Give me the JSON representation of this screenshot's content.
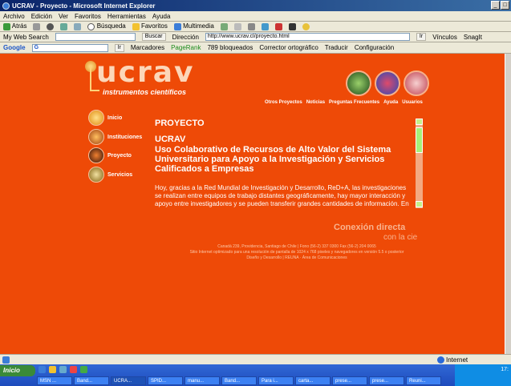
{
  "window": {
    "title": "UCRAV - Proyecto - Microsoft Internet Explorer"
  },
  "menu": [
    "Archivo",
    "Edición",
    "Ver",
    "Favoritos",
    "Herramientas",
    "Ayuda"
  ],
  "nav": {
    "back": "Atrás",
    "search": "Búsqueda",
    "favorites": "Favoritos",
    "multimedia": "Multimedia"
  },
  "addressbar": {
    "label_search": "My Web Search",
    "buscar": "Buscar",
    "label_dir": "Dirección",
    "url": "http://www.ucrav.cl/proyecto.html",
    "go": "Ir",
    "links": "Vínculos",
    "snagit": "SnagIt"
  },
  "google": {
    "label": "Google",
    "g": "G",
    "ir": "Ir",
    "bookmarks": "Marcadores",
    "pagerank": "PageRank",
    "blocked": "789 bloqueados",
    "spell": "Corrector ortográfico",
    "translate": "Traducir",
    "config": "Configuración"
  },
  "site": {
    "logo": "ucrav",
    "tagline": "instrumentos científicos",
    "topnav": [
      "Otros Proyectos",
      "Noticias",
      "Preguntas Frecuentes",
      "Ayuda",
      "Usuarios"
    ],
    "sidenav": [
      "Inicio",
      "Instituciones",
      "Proyecto",
      "Servicios"
    ],
    "section_title": "PROYECTO",
    "heading_1": "UCRAV",
    "heading_2": "Uso Colaborativo de Recursos de Alto Valor del Sistema Universitario para Apoyo a la Investigación y Servicios Calificados a Empresas",
    "body": "Hoy, gracias a la Red Mundial de Investigación y Desarrollo, ReD+A, las investigaciones\nse realizan entre equipos de trabajo distantes geográficamente, hay mayor interacción y\napoyo entre investigadores y se pueden transferir grandes cantidades de información. En",
    "conexion_1": "Conexión directa",
    "conexion_2": "con la cie",
    "footer_1": "Canadá 239, Providencia, Santiago de Chile | Fono (56-2) 337 0300 Fax (56-2) 204 0065",
    "footer_2": "Sitio Internet optimizado para una resolución de pantalla de 1024 x 768 pixeles y navegadores en versión 5.5 o posterior",
    "footer_3": "Diseño y Desarrollo | REUNA · Área de Comunicaciones"
  },
  "status": {
    "zone": "Internet"
  },
  "taskbar": {
    "start": "Inicio",
    "tasks": [
      "MSN ...",
      "Band...",
      "UCRA...",
      "SPID...",
      "manu...",
      "Band...",
      "Para i...",
      "carta...",
      "prese...",
      "prese...",
      "Reuni..."
    ],
    "clock": "17:"
  },
  "colors": {
    "accent": "#ee4a07",
    "titlebar": "#0a246a"
  }
}
